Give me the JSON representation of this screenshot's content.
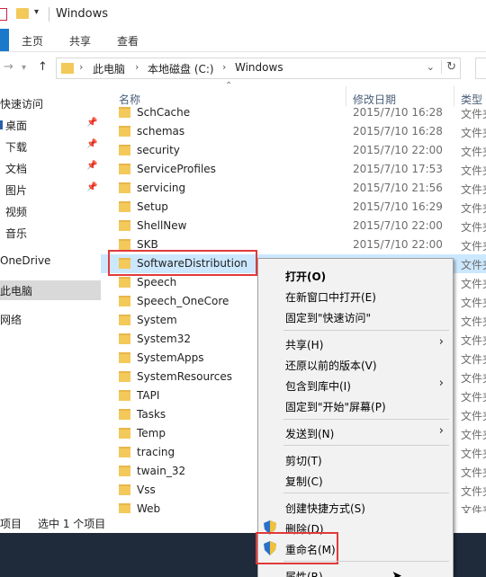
{
  "window": {
    "title": "Windows"
  },
  "ribbon": {
    "tabs": [
      "主页",
      "共享",
      "查看"
    ]
  },
  "address": {
    "crumbs": [
      "此电脑",
      "本地磁盘 (C:)",
      "Windows"
    ]
  },
  "nav": {
    "items": [
      {
        "label": "快速访问",
        "pinned": false
      },
      {
        "label": "桌面",
        "pinned": true
      },
      {
        "label": "下载",
        "pinned": true
      },
      {
        "label": "文档",
        "pinned": true
      },
      {
        "label": "图片",
        "pinned": true
      },
      {
        "label": "视频",
        "pinned": false
      },
      {
        "label": "音乐",
        "pinned": false
      },
      {
        "label": "OneDrive",
        "pinned": false
      },
      {
        "label": "此电脑",
        "pinned": false
      },
      {
        "label": "网络",
        "pinned": false
      }
    ]
  },
  "columns": {
    "name": "名称",
    "date": "修改日期",
    "type": "类型"
  },
  "files": [
    {
      "name": "SchCache",
      "date": "2015/7/10 16:28",
      "type": "文件夹"
    },
    {
      "name": "schemas",
      "date": "2015/7/10 16:28",
      "type": "文件夹"
    },
    {
      "name": "security",
      "date": "2015/7/10 22:00",
      "type": "文件夹"
    },
    {
      "name": "ServiceProfiles",
      "date": "2015/7/10 17:53",
      "type": "文件夹"
    },
    {
      "name": "servicing",
      "date": "2015/7/10 21:56",
      "type": "文件夹"
    },
    {
      "name": "Setup",
      "date": "2015/7/10 16:29",
      "type": "文件夹"
    },
    {
      "name": "ShellNew",
      "date": "2015/7/10 22:00",
      "type": "文件夹"
    },
    {
      "name": "SKB",
      "date": "2015/7/10 22:00",
      "type": "文件夹"
    },
    {
      "name": "SoftwareDistribution",
      "date": "",
      "type": "文件夹"
    },
    {
      "name": "Speech",
      "date": "",
      "type": "文件夹"
    },
    {
      "name": "Speech_OneCore",
      "date": "",
      "type": "文件夹"
    },
    {
      "name": "System",
      "date": "",
      "type": "文件夹"
    },
    {
      "name": "System32",
      "date": "",
      "type": "文件夹"
    },
    {
      "name": "SystemApps",
      "date": "",
      "type": "文件夹"
    },
    {
      "name": "SystemResources",
      "date": "",
      "type": "文件夹"
    },
    {
      "name": "TAPI",
      "date": "",
      "type": "文件夹"
    },
    {
      "name": "Tasks",
      "date": "",
      "type": "文件夹"
    },
    {
      "name": "Temp",
      "date": "",
      "type": "文件夹"
    },
    {
      "name": "tracing",
      "date": "",
      "type": "文件夹"
    },
    {
      "name": "twain_32",
      "date": "",
      "type": "文件夹"
    },
    {
      "name": "Vss",
      "date": "",
      "type": "文件夹"
    },
    {
      "name": "Web",
      "date": "",
      "type": "文件夹"
    }
  ],
  "status": {
    "count": "项目",
    "selected": "选中 1 个项目"
  },
  "context_menu": {
    "items": [
      {
        "label": "打开(O)",
        "bold": true,
        "submenu": false,
        "shield": false
      },
      {
        "label": "在新窗口中打开(E)",
        "bold": false,
        "submenu": false,
        "shield": false
      },
      {
        "label": "固定到\"快速访问\"",
        "bold": false,
        "submenu": false,
        "shield": false
      },
      {
        "sep": true
      },
      {
        "label": "共享(H)",
        "bold": false,
        "submenu": true,
        "shield": false
      },
      {
        "label": "还原以前的版本(V)",
        "bold": false,
        "submenu": false,
        "shield": false
      },
      {
        "label": "包含到库中(I)",
        "bold": false,
        "submenu": true,
        "shield": false
      },
      {
        "label": "固定到\"开始\"屏幕(P)",
        "bold": false,
        "submenu": false,
        "shield": false
      },
      {
        "sep": true
      },
      {
        "label": "发送到(N)",
        "bold": false,
        "submenu": true,
        "shield": false
      },
      {
        "sep": true
      },
      {
        "label": "剪切(T)",
        "bold": false,
        "submenu": false,
        "shield": false
      },
      {
        "label": "复制(C)",
        "bold": false,
        "submenu": false,
        "shield": false
      },
      {
        "sep": true
      },
      {
        "label": "创建快捷方式(S)",
        "bold": false,
        "submenu": false,
        "shield": false
      },
      {
        "label": "删除(D)",
        "bold": false,
        "submenu": false,
        "shield": true
      },
      {
        "label": "重命名(M)",
        "bold": false,
        "submenu": false,
        "shield": true
      },
      {
        "sep": true
      },
      {
        "label": "属性(R)",
        "bold": false,
        "submenu": false,
        "shield": false
      }
    ]
  },
  "colors": {
    "accent": "#1979ca",
    "selection": "#cce8ff",
    "highlight_box": "#e03a3a",
    "folder": "#f3c95a"
  }
}
